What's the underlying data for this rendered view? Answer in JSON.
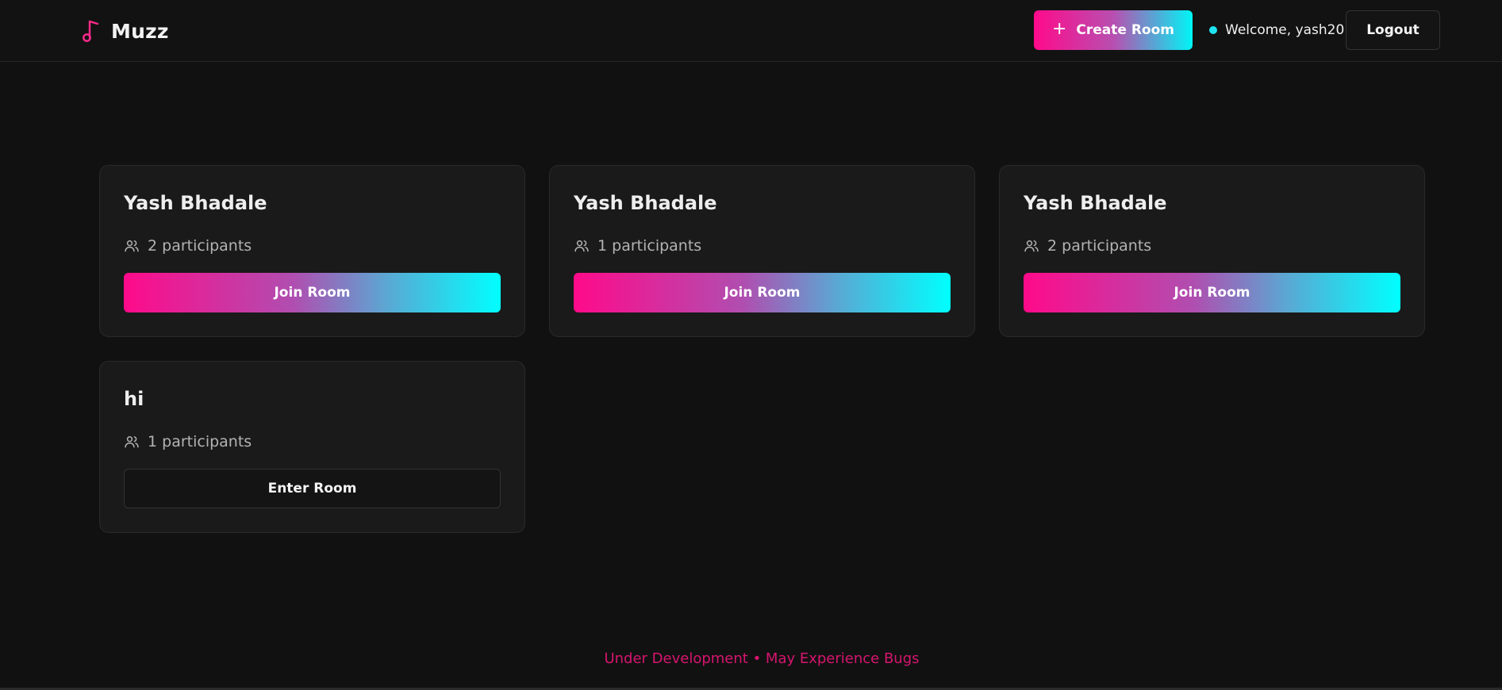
{
  "header": {
    "brand": "Muzz",
    "create_room_label": "Create Room",
    "welcome_text": "Welcome, yash20",
    "logout_label": "Logout"
  },
  "rooms": [
    {
      "name": "Yash Bhadale",
      "participants": "2 participants",
      "action": "Join Room"
    },
    {
      "name": "Yash Bhadale",
      "participants": "1 participants",
      "action": "Join Room"
    },
    {
      "name": "Yash Bhadale",
      "participants": "2 participants",
      "action": "Join Room"
    },
    {
      "name": "hi",
      "participants": "1 participants",
      "action": "Enter Room"
    }
  ],
  "footer": {
    "note": "Under Development • May Experience Bugs"
  },
  "colors": {
    "background": "#111111",
    "card": "#1a1a1a",
    "accent_pink": "#ff0a8a",
    "accent_cyan": "#00f5f5",
    "footer_text": "#d6156f",
    "status_dot": "#1fe3f0"
  },
  "icons": {
    "logo": "music-note-icon",
    "create": "plus-icon",
    "participants": "users-icon"
  }
}
